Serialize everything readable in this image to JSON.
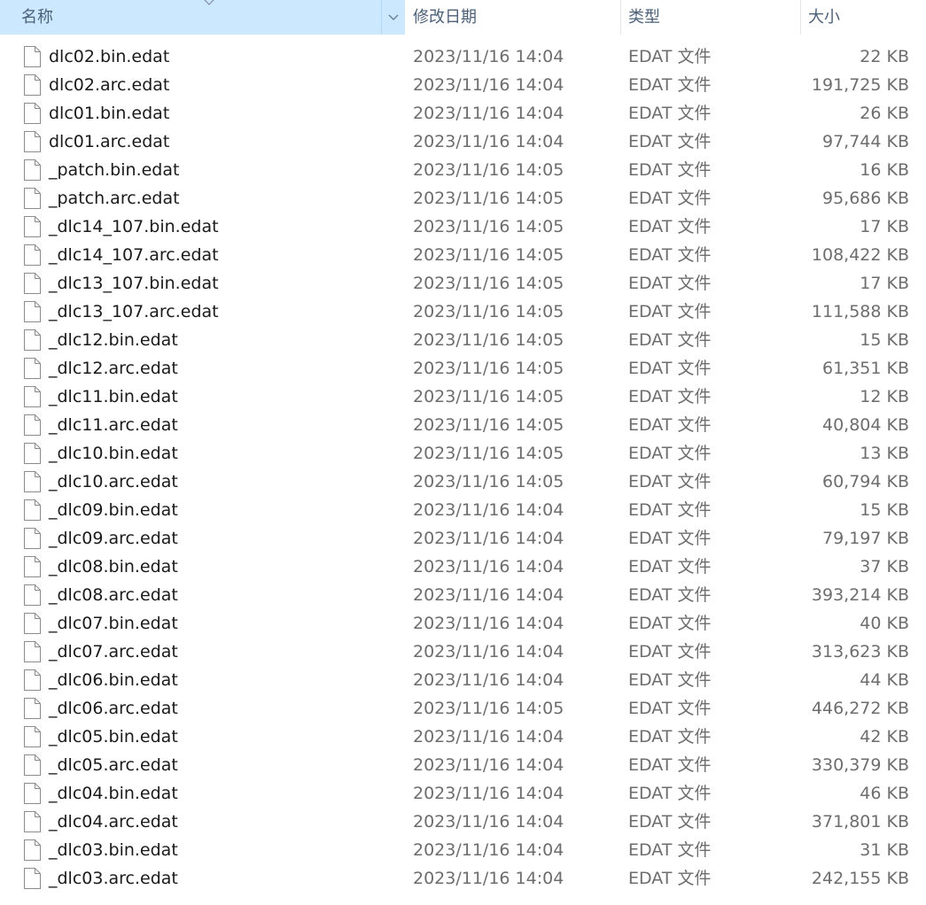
{
  "columns": {
    "name": "名称",
    "date": "修改日期",
    "type": "类型",
    "size": "大小"
  },
  "files": [
    {
      "name": "dlc02.bin.edat",
      "date": "2023/11/16 14:04",
      "type": "EDAT 文件",
      "size": "22 KB"
    },
    {
      "name": "dlc02.arc.edat",
      "date": "2023/11/16 14:04",
      "type": "EDAT 文件",
      "size": "191,725 KB"
    },
    {
      "name": "dlc01.bin.edat",
      "date": "2023/11/16 14:04",
      "type": "EDAT 文件",
      "size": "26 KB"
    },
    {
      "name": "dlc01.arc.edat",
      "date": "2023/11/16 14:04",
      "type": "EDAT 文件",
      "size": "97,744 KB"
    },
    {
      "name": "_patch.bin.edat",
      "date": "2023/11/16 14:05",
      "type": "EDAT 文件",
      "size": "16 KB"
    },
    {
      "name": "_patch.arc.edat",
      "date": "2023/11/16 14:05",
      "type": "EDAT 文件",
      "size": "95,686 KB"
    },
    {
      "name": "_dlc14_107.bin.edat",
      "date": "2023/11/16 14:05",
      "type": "EDAT 文件",
      "size": "17 KB"
    },
    {
      "name": "_dlc14_107.arc.edat",
      "date": "2023/11/16 14:05",
      "type": "EDAT 文件",
      "size": "108,422 KB"
    },
    {
      "name": "_dlc13_107.bin.edat",
      "date": "2023/11/16 14:05",
      "type": "EDAT 文件",
      "size": "17 KB"
    },
    {
      "name": "_dlc13_107.arc.edat",
      "date": "2023/11/16 14:05",
      "type": "EDAT 文件",
      "size": "111,588 KB"
    },
    {
      "name": "_dlc12.bin.edat",
      "date": "2023/11/16 14:05",
      "type": "EDAT 文件",
      "size": "15 KB"
    },
    {
      "name": "_dlc12.arc.edat",
      "date": "2023/11/16 14:05",
      "type": "EDAT 文件",
      "size": "61,351 KB"
    },
    {
      "name": "_dlc11.bin.edat",
      "date": "2023/11/16 14:05",
      "type": "EDAT 文件",
      "size": "12 KB"
    },
    {
      "name": "_dlc11.arc.edat",
      "date": "2023/11/16 14:05",
      "type": "EDAT 文件",
      "size": "40,804 KB"
    },
    {
      "name": "_dlc10.bin.edat",
      "date": "2023/11/16 14:05",
      "type": "EDAT 文件",
      "size": "13 KB"
    },
    {
      "name": "_dlc10.arc.edat",
      "date": "2023/11/16 14:05",
      "type": "EDAT 文件",
      "size": "60,794 KB"
    },
    {
      "name": "_dlc09.bin.edat",
      "date": "2023/11/16 14:04",
      "type": "EDAT 文件",
      "size": "15 KB"
    },
    {
      "name": "_dlc09.arc.edat",
      "date": "2023/11/16 14:04",
      "type": "EDAT 文件",
      "size": "79,197 KB"
    },
    {
      "name": "_dlc08.bin.edat",
      "date": "2023/11/16 14:04",
      "type": "EDAT 文件",
      "size": "37 KB"
    },
    {
      "name": "_dlc08.arc.edat",
      "date": "2023/11/16 14:04",
      "type": "EDAT 文件",
      "size": "393,214 KB"
    },
    {
      "name": "_dlc07.bin.edat",
      "date": "2023/11/16 14:04",
      "type": "EDAT 文件",
      "size": "40 KB"
    },
    {
      "name": "_dlc07.arc.edat",
      "date": "2023/11/16 14:04",
      "type": "EDAT 文件",
      "size": "313,623 KB"
    },
    {
      "name": "_dlc06.bin.edat",
      "date": "2023/11/16 14:04",
      "type": "EDAT 文件",
      "size": "44 KB"
    },
    {
      "name": "_dlc06.arc.edat",
      "date": "2023/11/16 14:05",
      "type": "EDAT 文件",
      "size": "446,272 KB"
    },
    {
      "name": "_dlc05.bin.edat",
      "date": "2023/11/16 14:04",
      "type": "EDAT 文件",
      "size": "42 KB"
    },
    {
      "name": "_dlc05.arc.edat",
      "date": "2023/11/16 14:04",
      "type": "EDAT 文件",
      "size": "330,379 KB"
    },
    {
      "name": "_dlc04.bin.edat",
      "date": "2023/11/16 14:04",
      "type": "EDAT 文件",
      "size": "46 KB"
    },
    {
      "name": "_dlc04.arc.edat",
      "date": "2023/11/16 14:04",
      "type": "EDAT 文件",
      "size": "371,801 KB"
    },
    {
      "name": "_dlc03.bin.edat",
      "date": "2023/11/16 14:04",
      "type": "EDAT 文件",
      "size": "31 KB"
    },
    {
      "name": "_dlc03.arc.edat",
      "date": "2023/11/16 14:04",
      "type": "EDAT 文件",
      "size": "242,155 KB"
    }
  ],
  "icons": {
    "sort": "sort-descending-icon",
    "dropdown": "chevron-down-icon",
    "file": "file-icon"
  },
  "colors": {
    "header_selected": "#cce8ff",
    "header_text": "#4c607a",
    "name_text": "#1a1a1a",
    "meta_text": "#6d6d6d"
  }
}
